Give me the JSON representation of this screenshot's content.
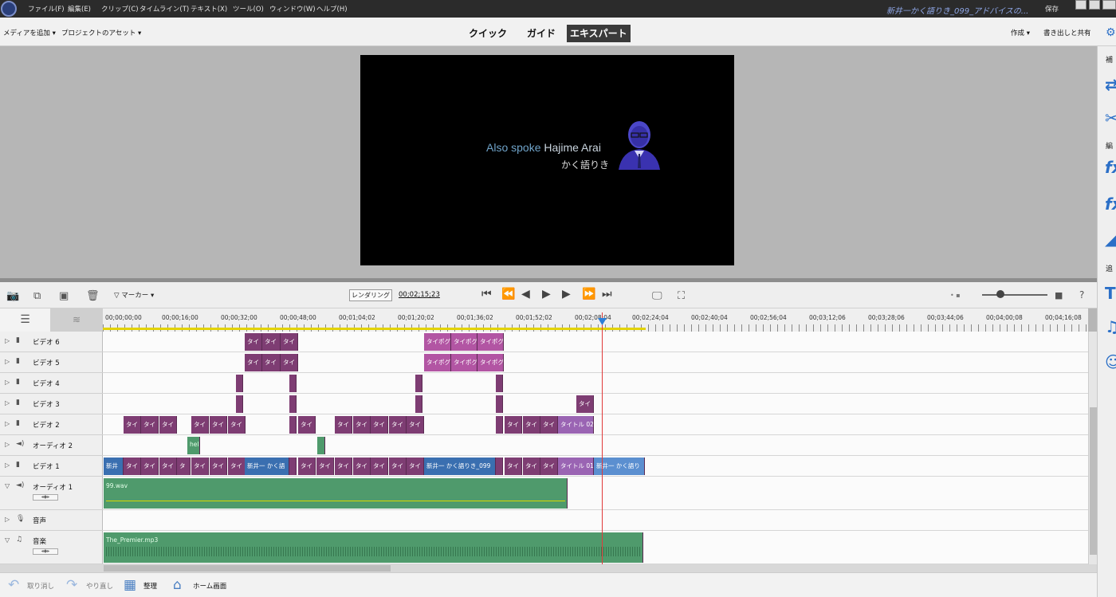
{
  "menubar": {
    "items": [
      "ファイル(F)",
      "編集(E)",
      "クリップ(C)",
      "タイムライン(T)",
      "テキスト(X)",
      "ツール(O)",
      "ウィンドウ(W)",
      "ヘルプ(H)"
    ],
    "document_title": "新井一かく語りき_099_アドバイスの...",
    "save_label": "保存"
  },
  "toolbar": {
    "add_media": "メディアを追加",
    "project_assets": "プロジェクトのアセット",
    "modes": [
      "クイック",
      "ガイド",
      "エキスパート"
    ],
    "active_mode": "エキスパート",
    "create": "作成",
    "export_share": "書き出しと共有"
  },
  "monitor": {
    "caption_line1_a": "Also spoke ",
    "caption_line1_b": "Hajime Arai",
    "caption_line2": "かく語りき"
  },
  "controls": {
    "marker": "マーカー",
    "render": "レンダリング",
    "timecode": "00;02;15;23"
  },
  "ruler": {
    "ticks": [
      "00;00;00;00",
      "00;00;16;00",
      "00;00;32;00",
      "00;00;48;00",
      "00;01;04;02",
      "00;01;20;02",
      "00;01;36;02",
      "00;01;52;02",
      "00;02;08;04",
      "00;02;24;04",
      "00;02;40;04",
      "00;02;56;04",
      "00;03;12;06",
      "00;03;28;06",
      "00;03;44;06",
      "00;04;00;08",
      "00;04;16;08"
    ]
  },
  "tracks": [
    {
      "name": "ビデオ 6",
      "kind": "video"
    },
    {
      "name": "ビデオ 5",
      "kind": "video"
    },
    {
      "name": "ビデオ 4",
      "kind": "video"
    },
    {
      "name": "ビデオ 3",
      "kind": "video"
    },
    {
      "name": "ビデオ 2",
      "kind": "video"
    },
    {
      "name": "オーディオ 2",
      "kind": "audio"
    },
    {
      "name": "ビデオ 1",
      "kind": "video"
    },
    {
      "name": "オーディオ 1",
      "kind": "audio"
    },
    {
      "name": "音声",
      "kind": "narration"
    },
    {
      "name": "音楽",
      "kind": "music"
    }
  ],
  "clips": {
    "short_title": "タイ",
    "title_pogu": "タイポグ",
    "title_02": "タイトル 02",
    "title_01": "タイトル 01",
    "hel": "hel",
    "shinai_prefix": "新井",
    "shinai_katari": "新井一 かく語",
    "shinai_099": "新井一 かく語りき_099",
    "shinai_end": "新井一 かく語り",
    "ta": "タ",
    "audio1": "99.wav",
    "music": "The_Premier.mp3"
  },
  "bottom": {
    "undo": "取り消し",
    "redo": "やり直し",
    "organize": "整理",
    "home": "ホーム画面"
  },
  "rightpanel": {
    "label1": "補",
    "label2": "編",
    "label3": "追"
  }
}
